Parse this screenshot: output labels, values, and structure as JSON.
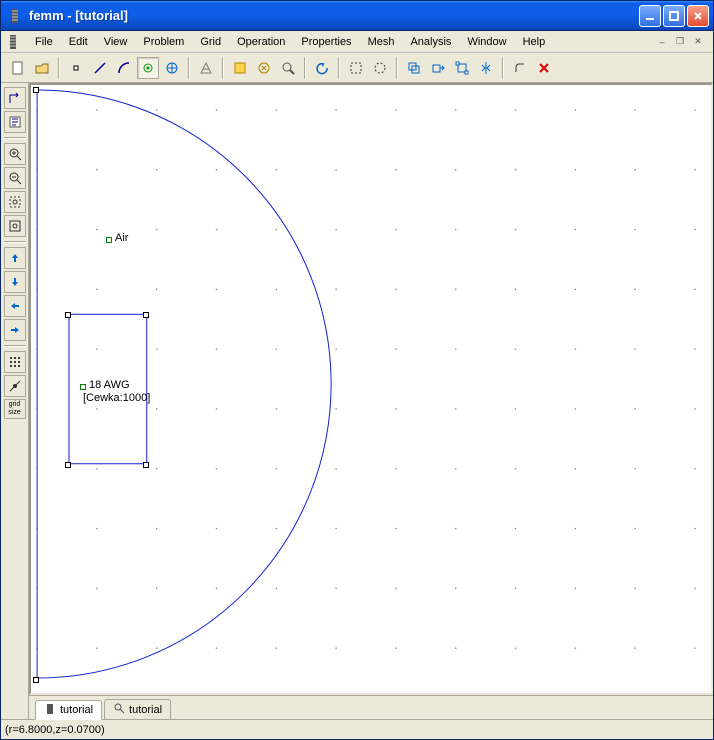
{
  "window": {
    "title": "femm - [tutorial]"
  },
  "menu": {
    "file": "File",
    "edit": "Edit",
    "view": "View",
    "problem": "Problem",
    "grid": "Grid",
    "operation": "Operation",
    "properties": "Properties",
    "mesh": "Mesh",
    "analysis": "Analysis",
    "window": "Window",
    "help": "Help"
  },
  "labels": {
    "air": "Air",
    "awg": "18 AWG",
    "circuit": "[Cewka:1000]"
  },
  "sidebar": {
    "gridsize": "grid\nsize"
  },
  "tabs": {
    "t1": "tutorial",
    "t2": "tutorial"
  },
  "status": {
    "coords": "(r=6.8000,z=0.0700)"
  }
}
